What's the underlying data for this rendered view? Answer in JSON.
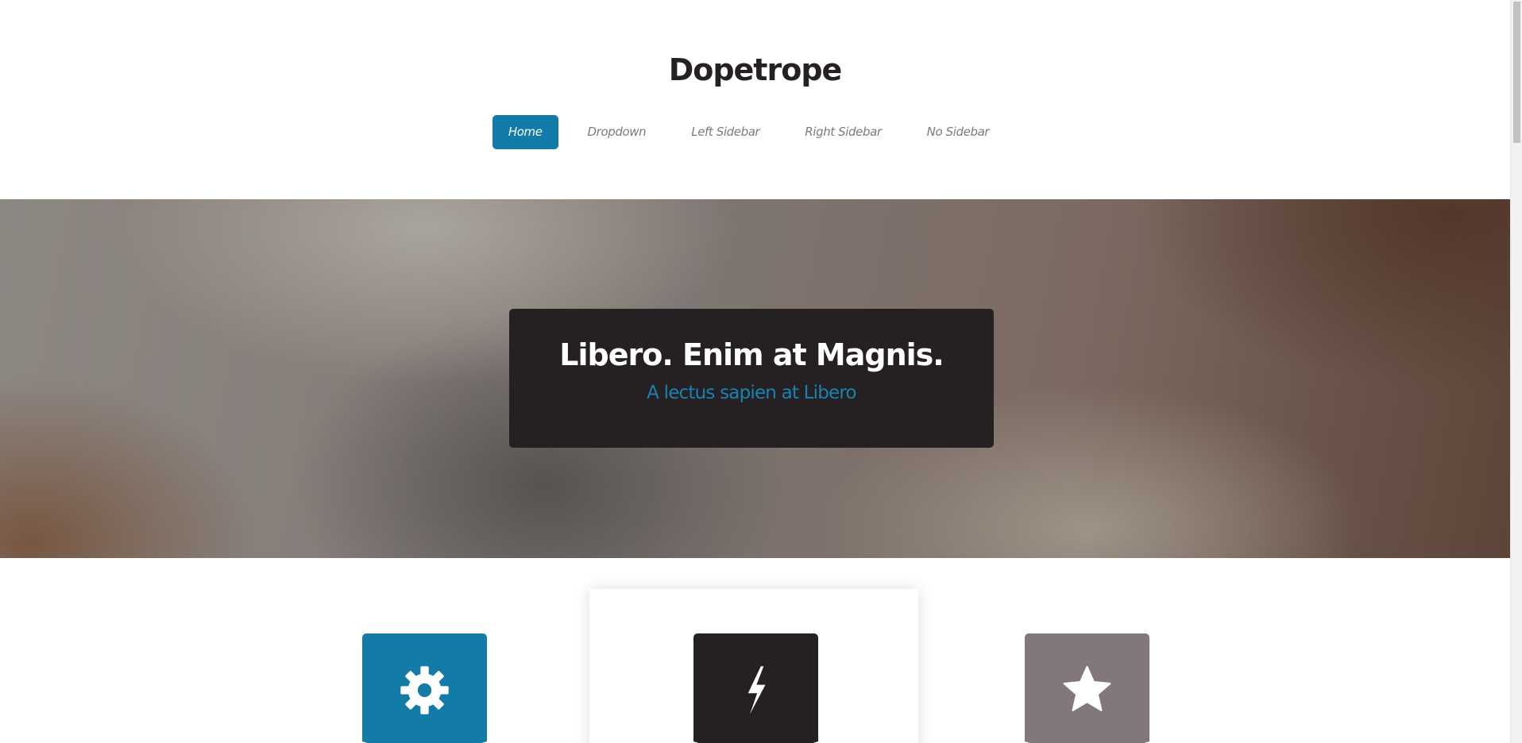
{
  "site": {
    "title": "Dopetrope"
  },
  "nav": {
    "items": [
      {
        "label": "Home",
        "active": true
      },
      {
        "label": "Dropdown",
        "active": false
      },
      {
        "label": "Left Sidebar",
        "active": false
      },
      {
        "label": "Right Sidebar",
        "active": false
      },
      {
        "label": "No Sidebar",
        "active": false
      }
    ]
  },
  "banner": {
    "heading": "Libero. Enim at Magnis.",
    "subheading": "A lectus sapien at Libero"
  },
  "features": [
    {
      "icon": "gear-icon",
      "color": "#127ba8"
    },
    {
      "icon": "bolt-icon",
      "color": "#252122"
    },
    {
      "icon": "star-icon",
      "color": "#827779"
    }
  ],
  "colors": {
    "accent": "#127ba8",
    "dark": "#252122",
    "muted": "#827779",
    "subheading": "#1a82b3"
  }
}
